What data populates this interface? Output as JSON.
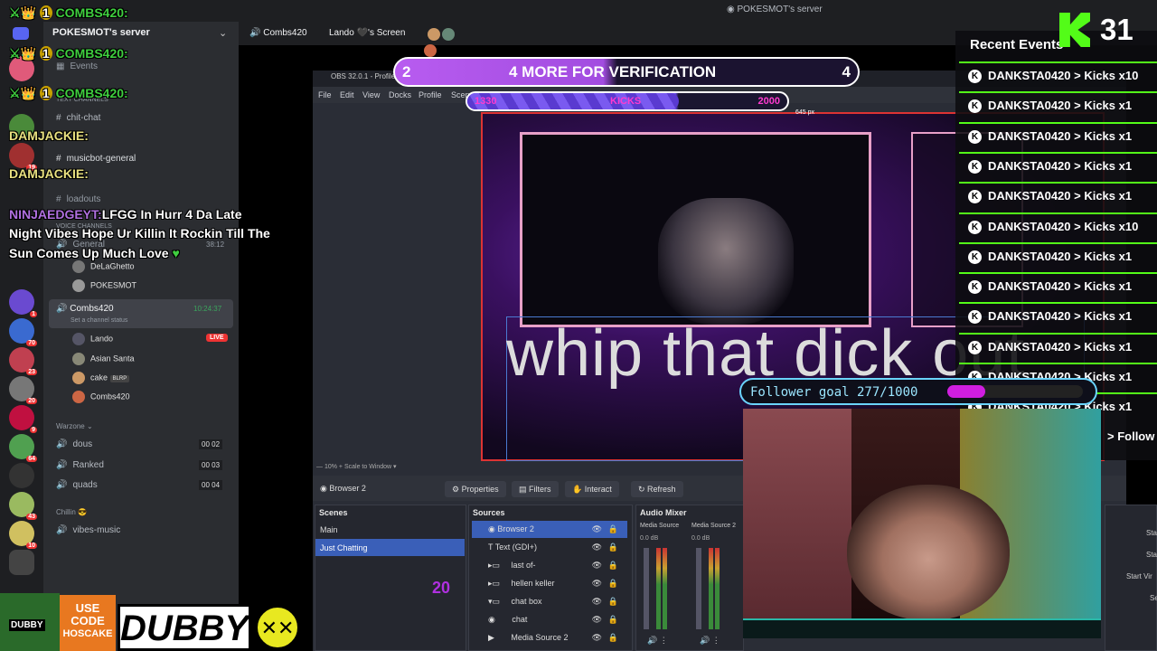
{
  "window": {
    "title": "POKESMOT's server"
  },
  "discord": {
    "server_name": "POKESMOT's server",
    "channels": {
      "events": "Events",
      "text_channels": "Text Channels",
      "chit_chat": "chit-chat",
      "musicbot_general": "musicbot-general",
      "loadouts": "loadouts",
      "voice_channels": "Voice Channels",
      "general": "General",
      "general_time": "38:12"
    },
    "voice_users_general": [
      "DeLaGhetto",
      "POKESMOT"
    ],
    "current_voice": {
      "name": "Combs420",
      "time": "10:24:37",
      "status": "Set a channel status"
    },
    "voice_users_current": [
      {
        "name": "Lando",
        "badge": "LIVE"
      },
      {
        "name": "Asian Santa",
        "badge": ""
      },
      {
        "name": "cake",
        "badge": "BLRP"
      },
      {
        "name": "Combs420",
        "badge": ""
      }
    ],
    "category_warzone": "Warzone",
    "warzone_channels": [
      {
        "name": "dous",
        "a": "00",
        "b": "02"
      },
      {
        "name": "Ranked",
        "a": "00",
        "b": "03"
      },
      {
        "name": "quads",
        "a": "00",
        "b": "04"
      }
    ],
    "category_chillin": "Chillin",
    "vibes_channel": "vibes-music",
    "rail_badges": [
      "19",
      "1",
      "70",
      "23",
      "20",
      "9",
      "64",
      "43",
      "10"
    ]
  },
  "topbar": {
    "voice_user": "Combs420",
    "screen_share": "Lando 🖤's Screen"
  },
  "chat_overlay": {
    "lines": [
      "COMBS420:",
      "COMBS420:",
      "COMBS420:"
    ],
    "badge_num": "1",
    "dam1": "DAMJACKIE:",
    "dam2": "DAMJACKIE:",
    "ninja_user": "NINJAEDGEYT:",
    "ninja_msg1": "LFGG In Hurr 4 Da Late",
    "ninja_msg2": "Night Vibes Hope Ur Killin It Rockin Till The",
    "ninja_msg3": "Sun Comes Up Much Love"
  },
  "obs": {
    "title": "OBS 32.0.1 - Profile",
    "menu": [
      "File",
      "Edit",
      "View",
      "Docks",
      "Profile",
      "Scen"
    ],
    "dimension_label": "645 px",
    "zoom": "10%",
    "scale_mode": "Scale to Window",
    "selected_source": "Browser 2",
    "toolbar": {
      "properties": "Properties",
      "filters": "Filters",
      "interact": "Interact",
      "refresh": "Refresh"
    },
    "scenes_label": "Scenes",
    "scenes": [
      "Main",
      "Just Chatting"
    ],
    "sources_label": "Sources",
    "sources": [
      "Browser 2",
      "Text (GDI+)",
      "last of-",
      "hellen keller",
      "chat box",
      "chat",
      "Media Source 2"
    ],
    "audio_label": "Audio Mixer",
    "audio_channels": [
      {
        "name": "Media Source",
        "db": "0.0 dB"
      },
      {
        "name": "Media Source 2",
        "db": "0.0 dB"
      }
    ],
    "right_panel": [
      "Sta",
      "Sta",
      "Start Vir",
      "Se"
    ]
  },
  "overlay": {
    "verification": {
      "left": "2",
      "text": "4 MORE FOR VERIFICATION",
      "right": "4"
    },
    "kicks_bar": {
      "left": "1330",
      "center": "KICKS",
      "right": "2000",
      "progress": 0.66
    },
    "subtitle": "whip that dick out",
    "follower_goal": {
      "text": "Follower goal 277/1000",
      "current": 277,
      "target": 1000
    },
    "score_num": "20",
    "kick_count": "31",
    "recent_events_title": "Recent Events",
    "events": [
      "DANKSTA0420 > Kicks x10",
      "DANKSTA0420 > Kicks x1",
      "DANKSTA0420 > Kicks x1",
      "DANKSTA0420 > Kicks x1",
      "DANKSTA0420 > Kicks x1",
      "DANKSTA0420 > Kicks x10",
      "DANKSTA0420 > Kicks x1",
      "DANKSTA0420 > Kicks x1",
      "DANKSTA0420 > Kicks x1",
      "DANKSTA0420 > Kicks x1",
      "DANKSTA0420 > Kicks x1",
      "DANKSTA0420 > Kicks x1"
    ],
    "follow_text": "> Follow"
  },
  "sponsor": {
    "brand": "DUBBY",
    "use_code_1": "USE",
    "use_code_2": "CODE",
    "code": "HOSCAKE"
  },
  "colors": {
    "kick_green": "#53fc18",
    "accent_purple": "#b85cf0",
    "discord_bg": "#2b2d31"
  }
}
